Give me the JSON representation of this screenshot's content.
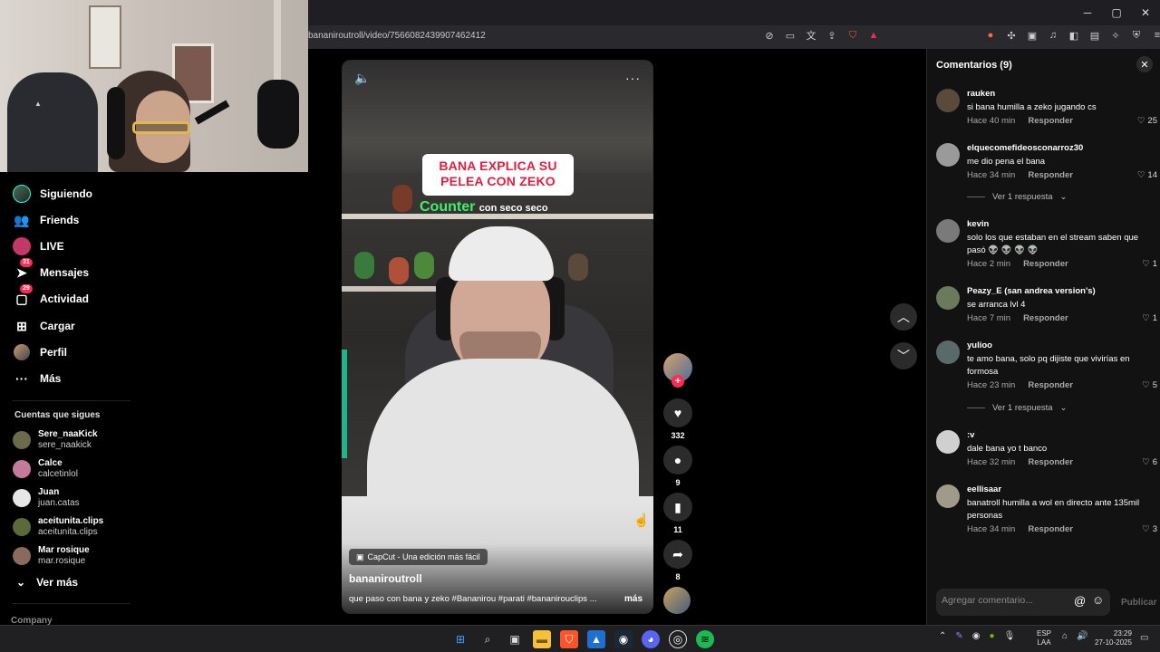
{
  "browser": {
    "url": "bananiroutroll/video/7566082439907462412",
    "win_min": "─",
    "win_max": "▢",
    "win_close": "✕"
  },
  "nav": {
    "items": [
      {
        "label": "Siguiendo",
        "icon": "following-avatar-icon"
      },
      {
        "label": "Friends",
        "icon": "friends-icon"
      },
      {
        "label": "LIVE",
        "icon": "live-icon"
      },
      {
        "label": "Mensajes",
        "icon": "messages-icon",
        "badge": "31"
      },
      {
        "label": "Actividad",
        "icon": "activity-icon",
        "badge": "29"
      },
      {
        "label": "Cargar",
        "icon": "upload-icon"
      },
      {
        "label": "Perfil",
        "icon": "profile-icon"
      },
      {
        "label": "Más",
        "icon": "more-icon"
      }
    ],
    "following_header": "Cuentas que sigues",
    "accounts": [
      {
        "name": "Sere_naaKick",
        "user": "sere_naakick",
        "color": "#6b6b4a"
      },
      {
        "name": "Calce",
        "user": "calcetinlol",
        "color": "#c47a9a"
      },
      {
        "name": "Juan",
        "user": "juan.catas",
        "color": "#e6e6e6"
      },
      {
        "name": "aceitunita.clips",
        "user": "aceitunita.clips",
        "color": "#5a6a3a"
      },
      {
        "name": "Mar rosique",
        "user": "mar.rosique",
        "color": "#8a6a5a"
      }
    ],
    "see_more": "Ver más",
    "company": "Company"
  },
  "video": {
    "title_line1": "BANA EXPLICA SU",
    "title_line2": "PELEA CON ZEKO",
    "counter": "Counter",
    "counter_sub": "con seco seco",
    "capcut": "CapCut - Una edición más fácil",
    "username": "bananiroutroll",
    "description": "que paso con bana y zeko #Bananirou #parati #bananirouclips ...",
    "more": "más"
  },
  "rail": {
    "likes": "332",
    "comments": "9",
    "saves": "11",
    "shares": "8"
  },
  "comments": {
    "title": "Comentarios (9)",
    "reply_label": "Responder",
    "view_replies": "Ver 1 respuesta",
    "input_placeholder": "Agregar comentario...",
    "publish": "Publicar",
    "items": [
      {
        "user": "rauken",
        "text": "si bana humilla a zeko jugando cs",
        "time": "Hace 40 min",
        "likes": "25",
        "color": "#5a4a3a"
      },
      {
        "user": "elquecomefideosconarroz30",
        "text": "me dio pena el bana",
        "time": "Hace 34 min",
        "likes": "14",
        "color": "#9a9a9a"
      },
      {
        "user": "kevin",
        "text": "solo los que estaban en el stream saben que pasó 👽 👽 👽 👽",
        "time": "Hace 2 min",
        "likes": "1",
        "color": "#7a7a7a"
      },
      {
        "user": "Peazy_E (san andrea version's)",
        "text": "se arranca lvl 4",
        "time": "Hace 7 min",
        "likes": "1",
        "color": "#6a7a5a"
      },
      {
        "user": "yulioo",
        "text": "te amo bana, solo pq dijiste que vivirías en formosa",
        "time": "Hace 23 min",
        "likes": "5",
        "color": "#5a6a6a"
      },
      {
        "user": ":v",
        "text": "dale bana yo t banco",
        "time": "Hace 32 min",
        "likes": "6",
        "color": "#d0d0d0"
      },
      {
        "user": "eellisaar",
        "text": "banatroll humilla a wol en directo ante 135mil personas",
        "time": "Hace 34 min",
        "likes": "3",
        "color": "#a09a8a"
      }
    ]
  },
  "taskbar": {
    "lang1": "ESP",
    "lang2": "LAA",
    "time": "23:29",
    "date": "27-10-2025"
  }
}
